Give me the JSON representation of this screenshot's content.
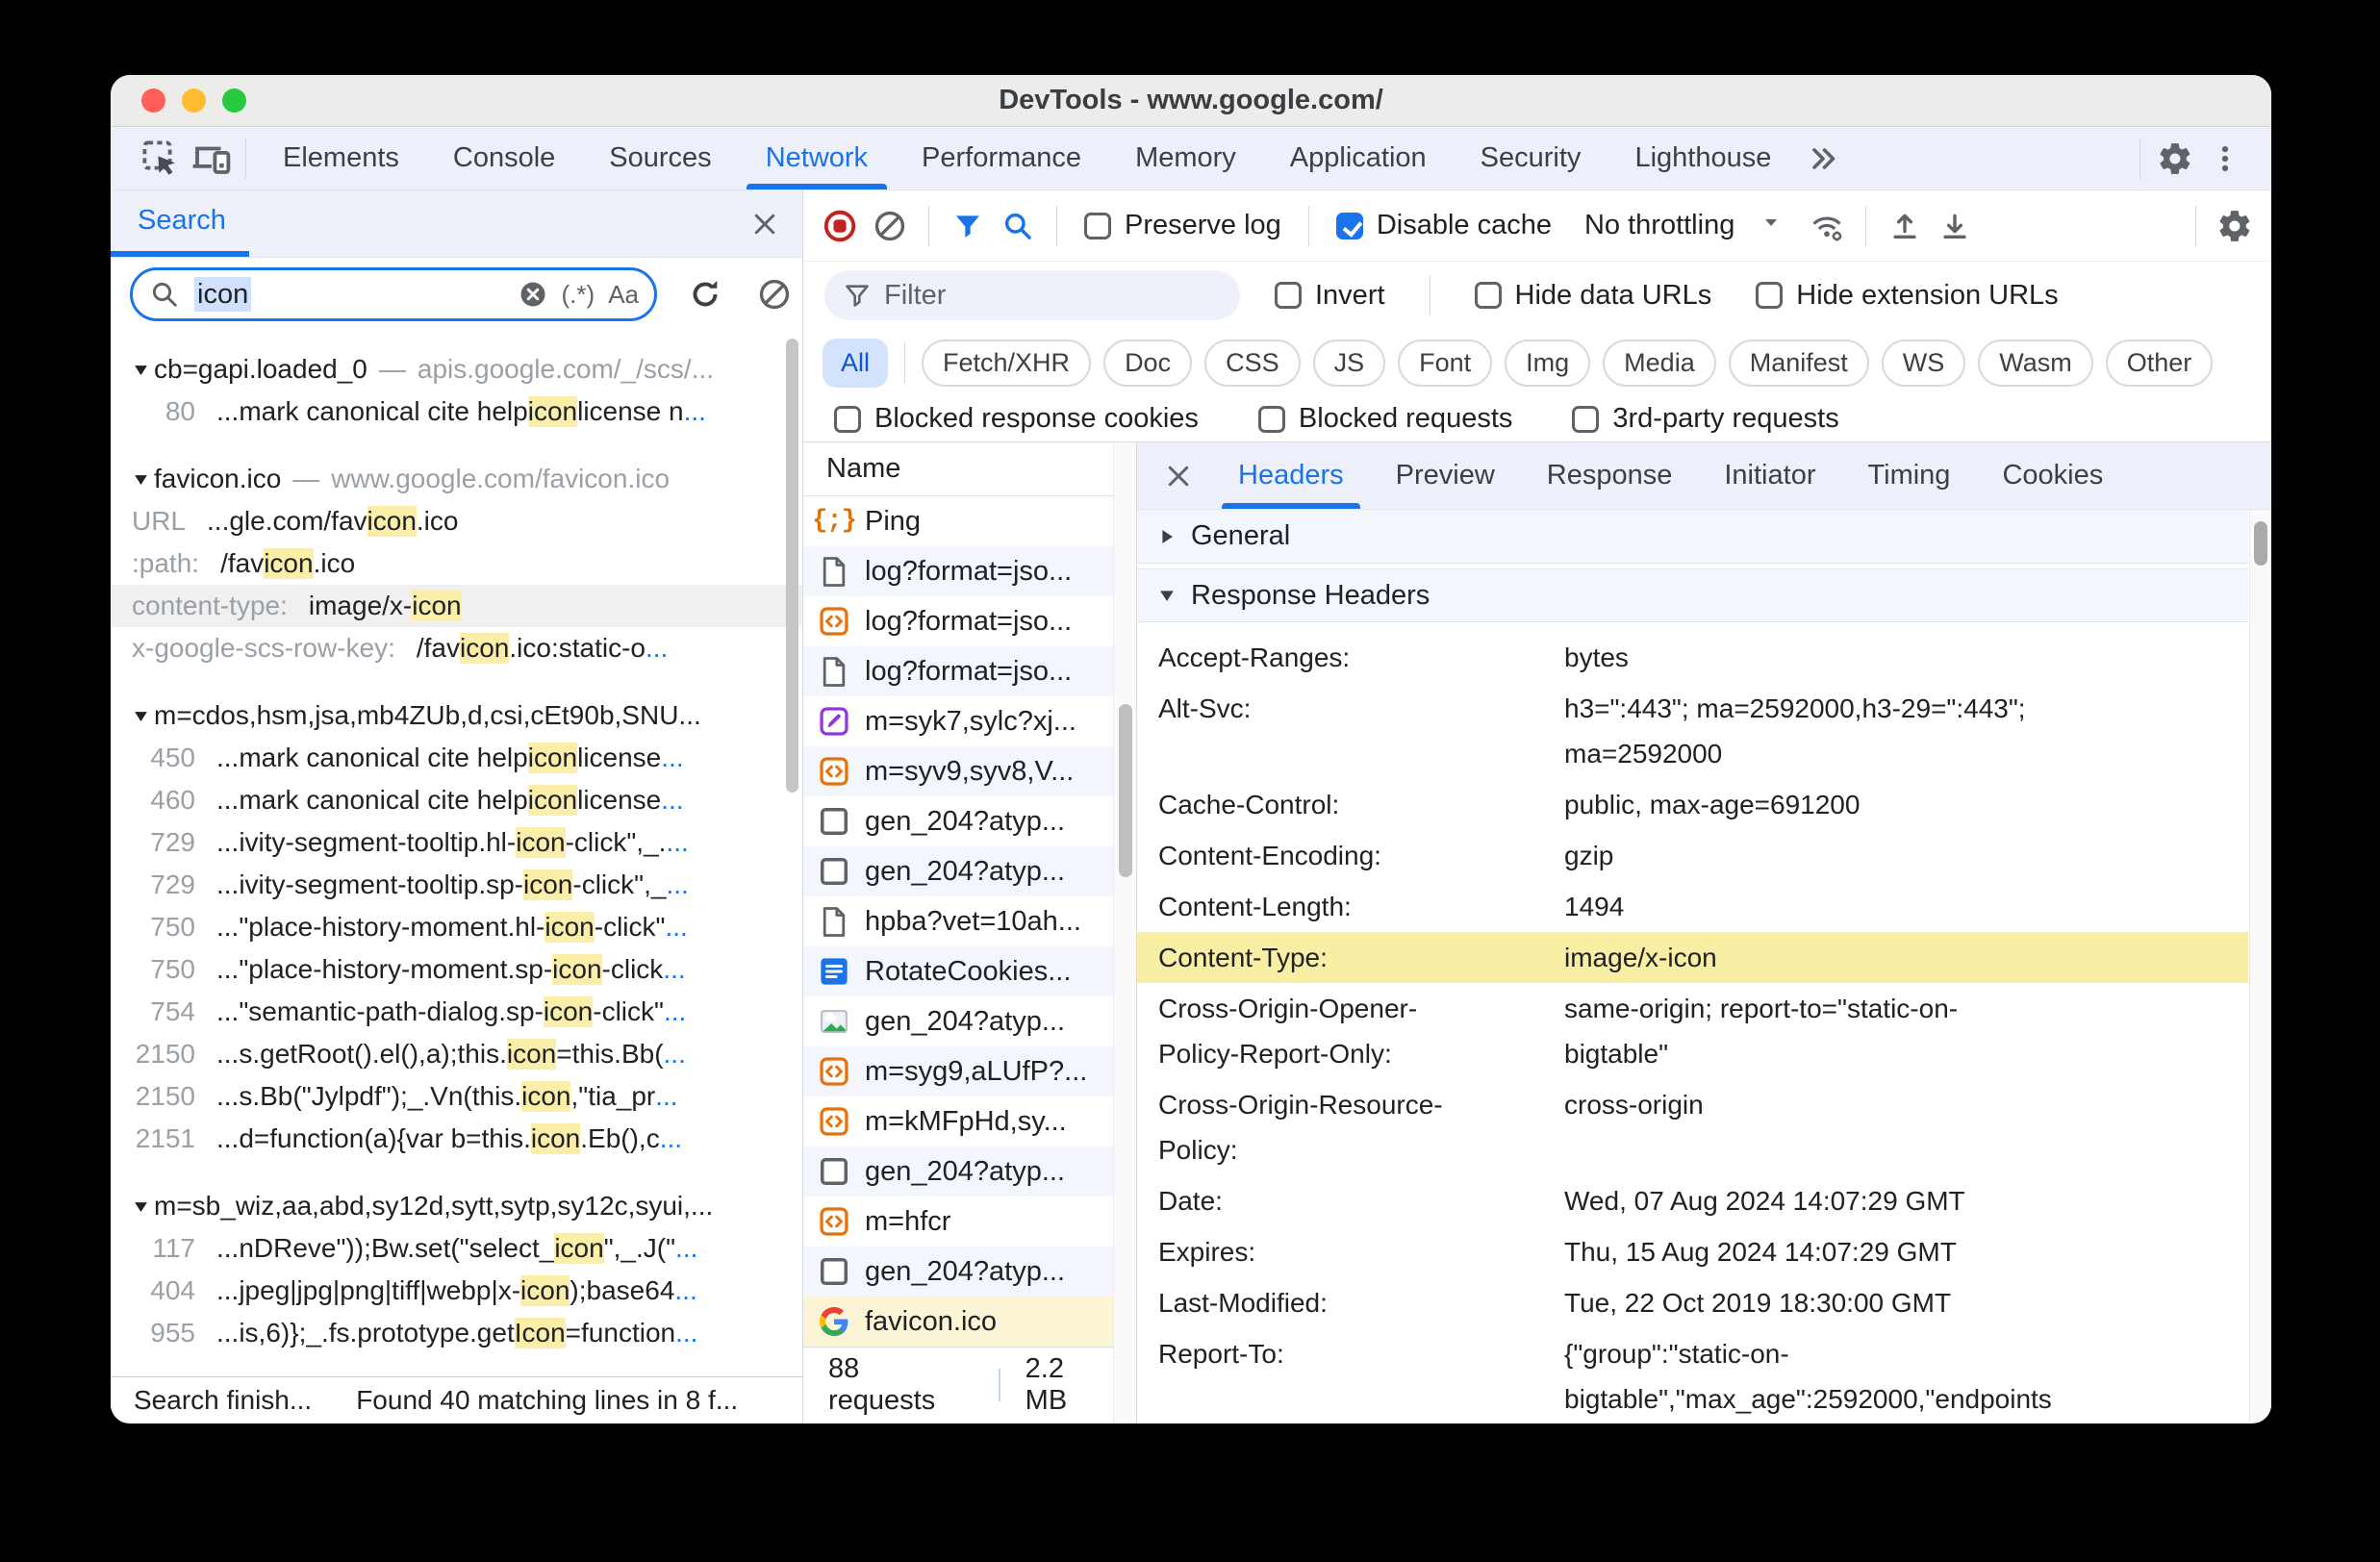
{
  "window": {
    "title": "DevTools - www.google.com/"
  },
  "main_tabs": {
    "items": [
      "Elements",
      "Console",
      "Sources",
      "Network",
      "Performance",
      "Memory",
      "Application",
      "Security",
      "Lighthouse"
    ],
    "active": "Network"
  },
  "search_panel": {
    "tab_label": "Search",
    "input": {
      "value": "icon",
      "regex_toggle": "(.*)",
      "case_toggle": "Aa"
    },
    "groups": [
      {
        "name": "cb=gapi.loaded_0",
        "url": "apis.google.com/_/scs/...",
        "matches": [
          {
            "left": "80",
            "type": "num",
            "segs": [
              {
                "t": "...mark canonical cite help "
              },
              {
                "t": "icon",
                "hl": true
              },
              {
                "t": " license n"
              },
              {
                "t": "...",
                "blue": true
              }
            ]
          }
        ]
      },
      {
        "name": "favicon.ico",
        "url": "www.google.com/favicon.ico",
        "matches": [
          {
            "left": "URL",
            "type": "lbl",
            "segs": [
              {
                "t": "...gle.com/fav"
              },
              {
                "t": "icon",
                "hl": true
              },
              {
                "t": ".ico"
              }
            ]
          },
          {
            "left": ":path:",
            "type": "lbl",
            "segs": [
              {
                "t": "/fav"
              },
              {
                "t": "icon",
                "hl": true
              },
              {
                "t": ".ico"
              }
            ]
          },
          {
            "left": "content-type:",
            "type": "lbl",
            "selected": true,
            "segs": [
              {
                "t": "image/x-"
              },
              {
                "t": "icon",
                "hl": true
              }
            ]
          },
          {
            "left": "x-google-scs-row-key:",
            "type": "lbl",
            "segs": [
              {
                "t": "/fav"
              },
              {
                "t": "icon",
                "hl": true
              },
              {
                "t": ".ico:static-o"
              },
              {
                "t": "...",
                "blue": true
              }
            ]
          }
        ]
      },
      {
        "name": "m=cdos,hsm,jsa,mb4ZUb,d,csi,cEt90b,SNU...",
        "url": "",
        "matches": [
          {
            "left": "450",
            "type": "num",
            "segs": [
              {
                "t": "...mark canonical cite help "
              },
              {
                "t": "icon",
                "hl": true
              },
              {
                "t": " license "
              },
              {
                "t": "...",
                "blue": true
              }
            ]
          },
          {
            "left": "460",
            "type": "num",
            "segs": [
              {
                "t": "...mark canonical cite help "
              },
              {
                "t": "icon",
                "hl": true
              },
              {
                "t": " license "
              },
              {
                "t": "...",
                "blue": true
              }
            ]
          },
          {
            "left": "729",
            "type": "num",
            "segs": [
              {
                "t": "...ivity-segment-tooltip.hl-"
              },
              {
                "t": "icon",
                "hl": true
              },
              {
                "t": "-click\",_."
              },
              {
                "t": "...",
                "blue": true
              }
            ]
          },
          {
            "left": "729",
            "type": "num",
            "segs": [
              {
                "t": "...ivity-segment-tooltip.sp-"
              },
              {
                "t": "icon",
                "hl": true
              },
              {
                "t": "-click\",_"
              },
              {
                "t": "...",
                "blue": true
              }
            ]
          },
          {
            "left": "750",
            "type": "num",
            "segs": [
              {
                "t": "...\"place-history-moment.hl-"
              },
              {
                "t": "icon",
                "hl": true
              },
              {
                "t": "-click\""
              },
              {
                "t": "...",
                "blue": true
              }
            ]
          },
          {
            "left": "750",
            "type": "num",
            "segs": [
              {
                "t": "...\"place-history-moment.sp-"
              },
              {
                "t": "icon",
                "hl": true
              },
              {
                "t": "-click"
              },
              {
                "t": "...",
                "blue": true
              }
            ]
          },
          {
            "left": "754",
            "type": "num",
            "segs": [
              {
                "t": "...\"semantic-path-dialog.sp-"
              },
              {
                "t": "icon",
                "hl": true
              },
              {
                "t": "-click\""
              },
              {
                "t": "...",
                "blue": true
              }
            ]
          },
          {
            "left": "2150",
            "type": "num",
            "segs": [
              {
                "t": "...s.getRoot().el(),a);this."
              },
              {
                "t": "icon",
                "hl": true
              },
              {
                "t": "=this.Bb("
              },
              {
                "t": "...",
                "blue": true
              }
            ]
          },
          {
            "left": "2150",
            "type": "num",
            "segs": [
              {
                "t": "...s.Bb(\"Jylpdf\");_.Vn(this."
              },
              {
                "t": "icon",
                "hl": true
              },
              {
                "t": ",\"tia_pr"
              },
              {
                "t": "...",
                "blue": true
              }
            ]
          },
          {
            "left": "2151",
            "type": "num",
            "segs": [
              {
                "t": "...d=function(a){var b=this."
              },
              {
                "t": "icon",
                "hl": true
              },
              {
                "t": ".Eb(),c"
              },
              {
                "t": "...",
                "blue": true
              }
            ]
          }
        ]
      },
      {
        "name": "m=sb_wiz,aa,abd,sy12d,sytt,sytp,sy12c,syui,...",
        "url": "",
        "matches": [
          {
            "left": "117",
            "type": "num",
            "segs": [
              {
                "t": "...nDReve\"));Bw.set(\"select_"
              },
              {
                "t": "icon",
                "hl": true
              },
              {
                "t": "\",_.J(\""
              },
              {
                "t": "...",
                "blue": true
              }
            ]
          },
          {
            "left": "404",
            "type": "num",
            "segs": [
              {
                "t": "...jpeg|jpg|png|tiff|webp|x-"
              },
              {
                "t": "icon",
                "hl": true
              },
              {
                "t": ");base64"
              },
              {
                "t": "...",
                "blue": true
              }
            ]
          },
          {
            "left": "955",
            "type": "num",
            "segs": [
              {
                "t": "...is,6)};_.fs.prototype.get"
              },
              {
                "t": "Icon",
                "hl": true
              },
              {
                "t": "=function"
              },
              {
                "t": "...",
                "blue": true
              }
            ]
          }
        ]
      }
    ],
    "status": {
      "left": "Search finish...",
      "right": "Found 40 matching lines in 8 f..."
    }
  },
  "network": {
    "toolbar": {
      "preserve_log": "Preserve log",
      "disable_cache": "Disable cache",
      "throttling": "No throttling"
    },
    "filter": {
      "placeholder": "Filter",
      "invert": "Invert",
      "hide_data_urls": "Hide data URLs",
      "hide_extension_urls": "Hide extension URLs"
    },
    "type_chips": {
      "items": [
        "All",
        "Fetch/XHR",
        "Doc",
        "CSS",
        "JS",
        "Font",
        "Img",
        "Media",
        "Manifest",
        "WS",
        "Wasm",
        "Other"
      ],
      "active": "All"
    },
    "request_filters": [
      "Blocked response cookies",
      "Blocked requests",
      "3rd-party requests"
    ],
    "table": {
      "name_header": "Name",
      "requests": [
        {
          "name": "Ping",
          "icon": "fetch-icon"
        },
        {
          "name": "log?format=jso...",
          "icon": "document-icon"
        },
        {
          "name": "log?format=jso...",
          "icon": "script-icon"
        },
        {
          "name": "log?format=jso...",
          "icon": "document-icon"
        },
        {
          "name": "m=syk7,sylc?xj...",
          "icon": "stylesheet-icon"
        },
        {
          "name": "m=syv9,syv8,V...",
          "icon": "script-icon"
        },
        {
          "name": "gen_204?atyp...",
          "icon": "generic-icon"
        },
        {
          "name": "gen_204?atyp...",
          "icon": "generic-icon"
        },
        {
          "name": "hpba?vet=10ah...",
          "icon": "document-icon"
        },
        {
          "name": "RotateCookies...",
          "icon": "json-doc-icon"
        },
        {
          "name": "gen_204?atyp...",
          "icon": "image-icon"
        },
        {
          "name": "m=syg9,aLUfP?...",
          "icon": "script-icon"
        },
        {
          "name": "m=kMFpHd,sy...",
          "icon": "script-icon"
        },
        {
          "name": "gen_204?atyp...",
          "icon": "generic-icon"
        },
        {
          "name": "m=hfcr",
          "icon": "script-icon"
        },
        {
          "name": "gen_204?atyp...",
          "icon": "generic-icon"
        },
        {
          "name": "favicon.ico",
          "icon": "google-favicon-icon",
          "selected": true
        }
      ],
      "status": {
        "requests": "88 requests",
        "size": "2.2 MB"
      }
    },
    "details": {
      "tabs": [
        "Headers",
        "Preview",
        "Response",
        "Initiator",
        "Timing",
        "Cookies"
      ],
      "active_tab": "Headers",
      "sections": {
        "general": "General",
        "response_headers": "Response Headers"
      },
      "response_headers": [
        {
          "key": "Accept-Ranges:",
          "value": "bytes"
        },
        {
          "key": "Alt-Svc:",
          "value": "h3=\":443\"; ma=2592000,h3-29=\":443\"; ma=2592000"
        },
        {
          "key": "Cache-Control:",
          "value": "public, max-age=691200"
        },
        {
          "key": "Content-Encoding:",
          "value": "gzip"
        },
        {
          "key": "Content-Length:",
          "value": "1494"
        },
        {
          "key": "Content-Type:",
          "value": "image/x-icon",
          "highlight": true
        },
        {
          "key": "Cross-Origin-Opener-Policy-Report-Only:",
          "value": "same-origin; report-to=\"static-on-bigtable\""
        },
        {
          "key": "Cross-Origin-Resource-Policy:",
          "value": "cross-origin"
        },
        {
          "key": "Date:",
          "value": "Wed, 07 Aug 2024 14:07:29 GMT"
        },
        {
          "key": "Expires:",
          "value": "Thu, 15 Aug 2024 14:07:29 GMT"
        },
        {
          "key": "Last-Modified:",
          "value": "Tue, 22 Oct 2019 18:30:00 GMT"
        },
        {
          "key": "Report-To:",
          "value": "{\"group\":\"static-on-bigtable\",\"max_age\":2592000,\"endpoints\""
        }
      ]
    }
  },
  "colors": {
    "accent": "#1a73e8",
    "record_red": "#c5221f",
    "match_yellow": "#fbeea8",
    "selected_row_yellow": "#fbf4d5",
    "header_highlight": "#f8efa4"
  },
  "icons": {
    "search": "🔍",
    "gear": "⚙",
    "close": "✕",
    "block": "⊘",
    "caret_down": "▼",
    "expand_open": "▼",
    "expand_closed": "▶",
    "more_tabs": "»"
  }
}
